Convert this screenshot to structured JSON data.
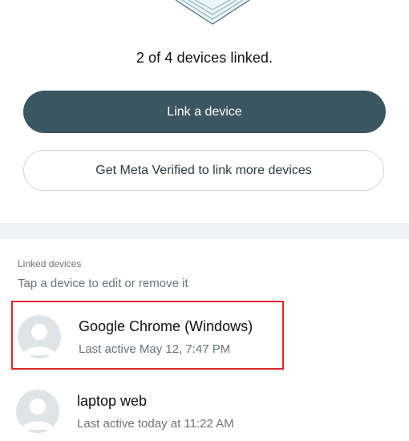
{
  "status": {
    "text": "2 of 4 devices linked."
  },
  "actions": {
    "link_label": "Link a device",
    "verified_label": "Get Meta Verified to link more devices"
  },
  "linked_devices": {
    "heading": "Linked devices",
    "subtext": "Tap a device to edit or remove it",
    "items": [
      {
        "name": "Google Chrome (Windows)",
        "last_active": "Last active May 12, 7:47 PM",
        "icon": "default-avatar-icon",
        "highlighted": true
      },
      {
        "name": "laptop web",
        "last_active": "Last active today at 11:22 AM",
        "icon": "default-avatar-icon",
        "highlighted": false
      }
    ]
  },
  "colors": {
    "primary_button": "#3b5561",
    "highlight_border": "#e0262c",
    "divider_band": "#f0f2f5",
    "avatar_bg": "#dfe5e7"
  }
}
